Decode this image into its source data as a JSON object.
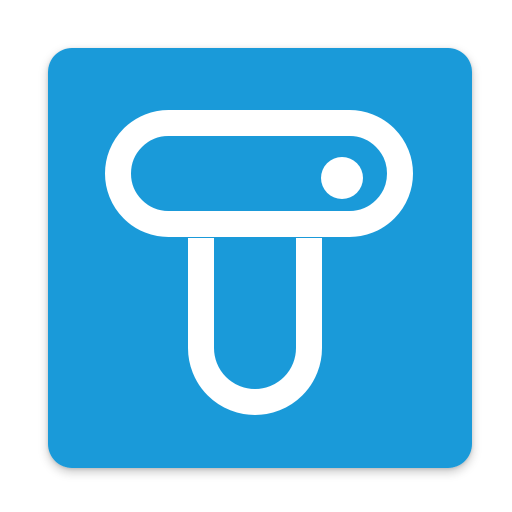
{
  "icon": {
    "name": "app-launcher-icon",
    "glyph": "stylized-t-logo",
    "colors": {
      "background": "#1a9ad9",
      "glyph": "#ffffff",
      "page": "#ffffff"
    }
  }
}
